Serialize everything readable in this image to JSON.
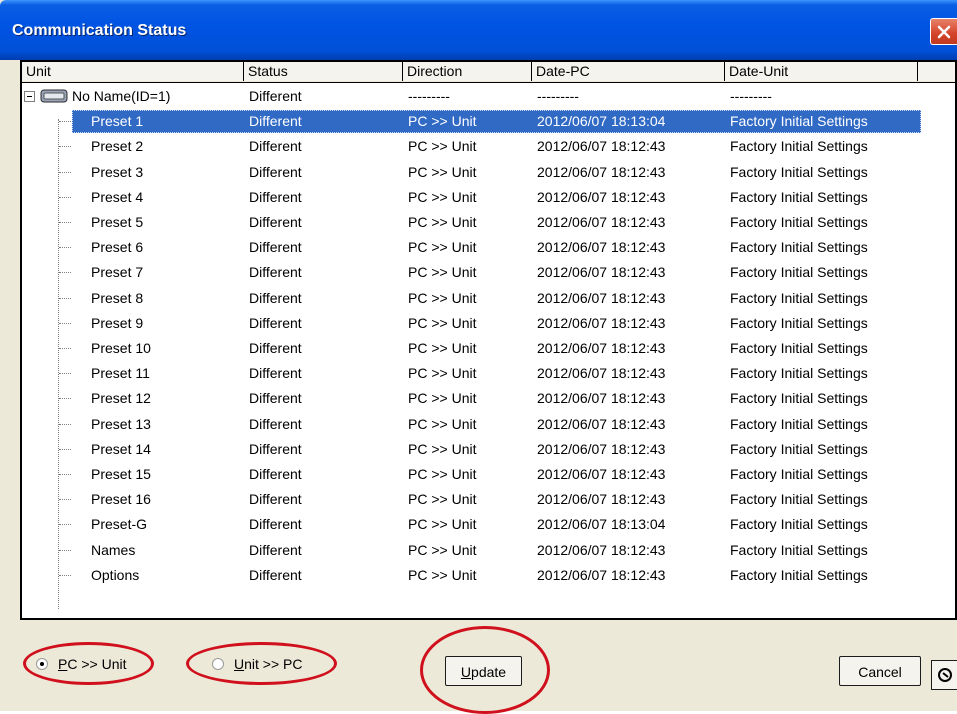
{
  "window": {
    "title": "Communication Status"
  },
  "columns": [
    "Unit",
    "Status",
    "Direction",
    "Date-PC",
    "Date-Unit"
  ],
  "root": {
    "unit": "No Name(ID=1)",
    "status": "Different",
    "direction": "---------",
    "date_pc": "---------",
    "date_unit": "---------"
  },
  "rows": [
    {
      "unit": "Preset 1",
      "status": "Different",
      "direction": "PC >> Unit",
      "date_pc": "2012/06/07 18:13:04",
      "date_unit": "Factory Initial Settings",
      "selected": true
    },
    {
      "unit": "Preset 2",
      "status": "Different",
      "direction": "PC >> Unit",
      "date_pc": "2012/06/07 18:12:43",
      "date_unit": "Factory Initial Settings"
    },
    {
      "unit": "Preset 3",
      "status": "Different",
      "direction": "PC >> Unit",
      "date_pc": "2012/06/07 18:12:43",
      "date_unit": "Factory Initial Settings"
    },
    {
      "unit": "Preset 4",
      "status": "Different",
      "direction": "PC >> Unit",
      "date_pc": "2012/06/07 18:12:43",
      "date_unit": "Factory Initial Settings"
    },
    {
      "unit": "Preset 5",
      "status": "Different",
      "direction": "PC >> Unit",
      "date_pc": "2012/06/07 18:12:43",
      "date_unit": "Factory Initial Settings"
    },
    {
      "unit": "Preset 6",
      "status": "Different",
      "direction": "PC >> Unit",
      "date_pc": "2012/06/07 18:12:43",
      "date_unit": "Factory Initial Settings"
    },
    {
      "unit": "Preset 7",
      "status": "Different",
      "direction": "PC >> Unit",
      "date_pc": "2012/06/07 18:12:43",
      "date_unit": "Factory Initial Settings"
    },
    {
      "unit": "Preset 8",
      "status": "Different",
      "direction": "PC >> Unit",
      "date_pc": "2012/06/07 18:12:43",
      "date_unit": "Factory Initial Settings"
    },
    {
      "unit": "Preset 9",
      "status": "Different",
      "direction": "PC >> Unit",
      "date_pc": "2012/06/07 18:12:43",
      "date_unit": "Factory Initial Settings"
    },
    {
      "unit": "Preset 10",
      "status": "Different",
      "direction": "PC >> Unit",
      "date_pc": "2012/06/07 18:12:43",
      "date_unit": "Factory Initial Settings"
    },
    {
      "unit": "Preset 11",
      "status": "Different",
      "direction": "PC >> Unit",
      "date_pc": "2012/06/07 18:12:43",
      "date_unit": "Factory Initial Settings"
    },
    {
      "unit": "Preset 12",
      "status": "Different",
      "direction": "PC >> Unit",
      "date_pc": "2012/06/07 18:12:43",
      "date_unit": "Factory Initial Settings"
    },
    {
      "unit": "Preset 13",
      "status": "Different",
      "direction": "PC >> Unit",
      "date_pc": "2012/06/07 18:12:43",
      "date_unit": "Factory Initial Settings"
    },
    {
      "unit": "Preset 14",
      "status": "Different",
      "direction": "PC >> Unit",
      "date_pc": "2012/06/07 18:12:43",
      "date_unit": "Factory Initial Settings"
    },
    {
      "unit": "Preset 15",
      "status": "Different",
      "direction": "PC >> Unit",
      "date_pc": "2012/06/07 18:12:43",
      "date_unit": "Factory Initial Settings"
    },
    {
      "unit": "Preset 16",
      "status": "Different",
      "direction": "PC >> Unit",
      "date_pc": "2012/06/07 18:12:43",
      "date_unit": "Factory Initial Settings"
    },
    {
      "unit": "Preset-G",
      "status": "Different",
      "direction": "PC >> Unit",
      "date_pc": "2012/06/07 18:13:04",
      "date_unit": "Factory Initial Settings"
    },
    {
      "unit": "Names",
      "status": "Different",
      "direction": "PC >> Unit",
      "date_pc": "2012/06/07 18:12:43",
      "date_unit": "Factory Initial Settings"
    },
    {
      "unit": "Options",
      "status": "Different",
      "direction": "PC >> Unit",
      "date_pc": "2012/06/07 18:12:43",
      "date_unit": "Factory Initial Settings"
    }
  ],
  "transfer": {
    "pc_to_unit": {
      "underlined": "P",
      "rest": "C >> Unit",
      "checked": true
    },
    "unit_to_pc": {
      "underlined": "U",
      "rest": "nit >> PC",
      "checked": false
    }
  },
  "buttons": {
    "update": {
      "underlined": "U",
      "rest": "pdate"
    },
    "cancel": "Cancel"
  },
  "colors": {
    "selection": "#316ac5",
    "highlight_ring": "#d0101c",
    "titlebar": "#0054e3"
  }
}
